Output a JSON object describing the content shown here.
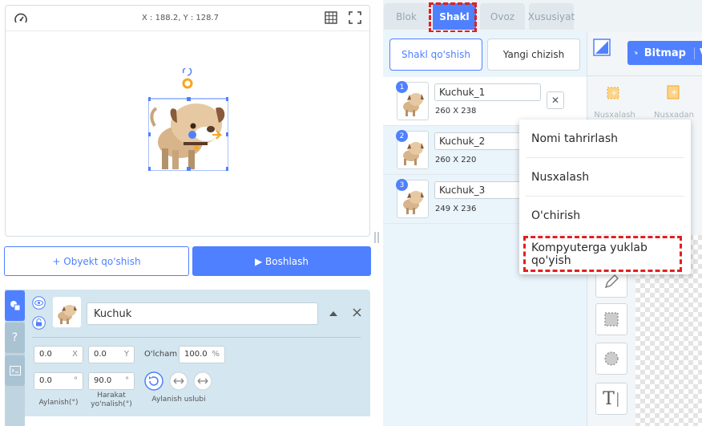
{
  "stage": {
    "coords": "X : 188.2, Y : 128.7"
  },
  "buttons": {
    "add_object": "+ Obyekt qo'shish",
    "start": "▶ Boshlash"
  },
  "object": {
    "name": "Kuchuk",
    "x": "0.0",
    "x_unit": "X",
    "y": "0.0",
    "y_unit": "Y",
    "size_label": "O'lcham",
    "size": "100.0",
    "size_unit": "%",
    "rotation": "0.0",
    "rotation_unit": "°",
    "direction": "90.0",
    "direction_unit": "°",
    "rotation_label": "Aylanish(°)",
    "direction_label": "Harakat yo'nalish(°)",
    "rotation_style_label": "Aylanish uslubi",
    "help_tab": "?"
  },
  "tabs": [
    "Blok",
    "Shakl",
    "Ovoz",
    "Xususiyat"
  ],
  "shape_panel": {
    "add_shape": "Shakl qo'shish",
    "new_draw": "Yangi chizish",
    "shapes": [
      {
        "num": "1",
        "name": "Kuchuk_1",
        "size": "260 X 238"
      },
      {
        "num": "2",
        "name": "Kuchuk_2",
        "size": "260 X 220"
      },
      {
        "num": "3",
        "name": "Kuchuk_3",
        "size": "249 X 236"
      }
    ],
    "delete_icon": "✕"
  },
  "editor": {
    "bitmap": "Bitmap",
    "copy_label": "Nusxalash",
    "paste_label": "Nusxadan",
    "text_tool": "T"
  },
  "context_menu": [
    "Nomi tahrirlash",
    "Nusxalash",
    "O'chirish",
    "Kompyuterga yuklab qo'yish"
  ],
  "colors": {
    "accent": "#4f80ff",
    "highlight": "#e02020",
    "orange": "#f5a623"
  }
}
